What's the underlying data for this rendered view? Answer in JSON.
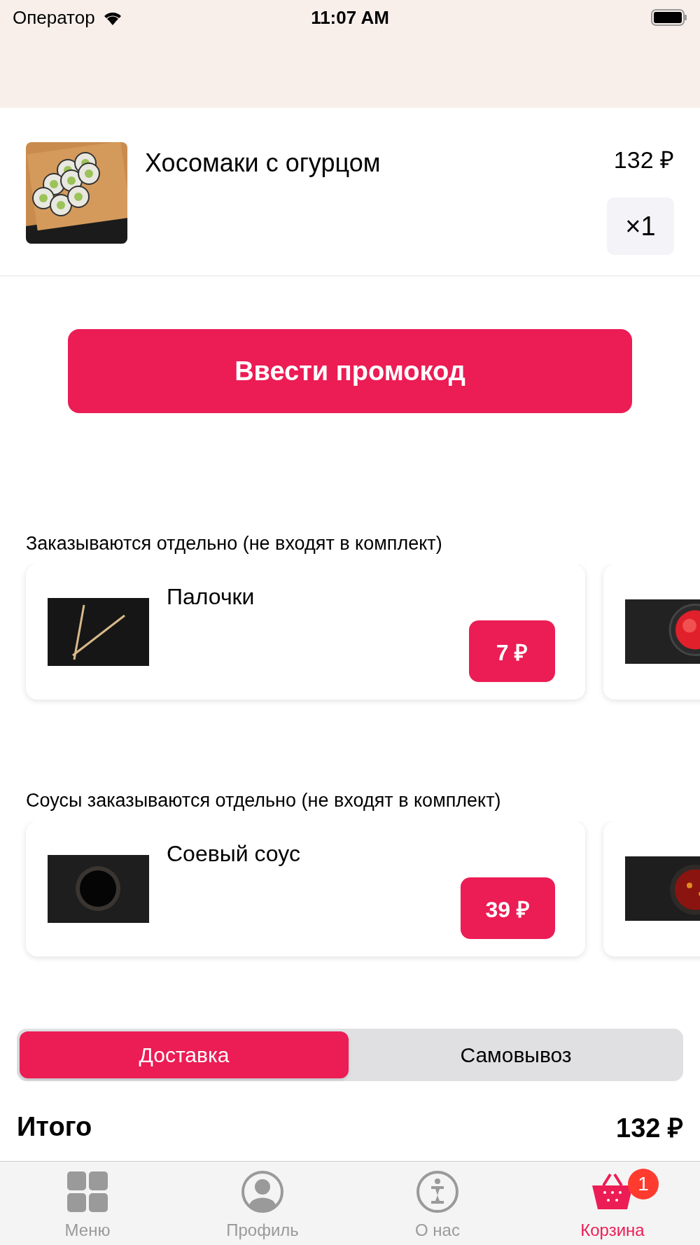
{
  "status_bar": {
    "carrier": "Оператор",
    "time": "11:07 AM"
  },
  "cart_items": [
    {
      "name": "Хосомаки с огурцом",
      "price": "132 ₽",
      "quantity": "×1"
    }
  ],
  "promo_button": "Ввести промокод",
  "sections": [
    {
      "title": "Заказываются отдельно (не входят в комплект)",
      "items": [
        {
          "kind": "product",
          "name": "Палочки",
          "price": "7 ₽"
        },
        {
          "kind": "cut_off"
        }
      ]
    },
    {
      "title": "Соусы заказываются отдельно (не входят в комплект)",
      "items": [
        {
          "kind": "product",
          "name": "Соевый соус",
          "price": "39 ₽"
        },
        {
          "kind": "cut_off"
        }
      ]
    }
  ],
  "delivery_options": [
    {
      "label": "Доставка",
      "selected": true
    },
    {
      "label": "Самовывоз",
      "selected": false
    }
  ],
  "total": {
    "label": "Итого",
    "value": "132 ₽"
  },
  "tab_bar": [
    {
      "kind": "grid",
      "label": "Меню",
      "selected": false
    },
    {
      "kind": "profile",
      "label": "Профиль",
      "selected": false
    },
    {
      "kind": "info",
      "label": "О нас",
      "selected": false
    },
    {
      "kind": "basket",
      "label": "Корзина",
      "selected": true,
      "badge": "1"
    }
  ]
}
